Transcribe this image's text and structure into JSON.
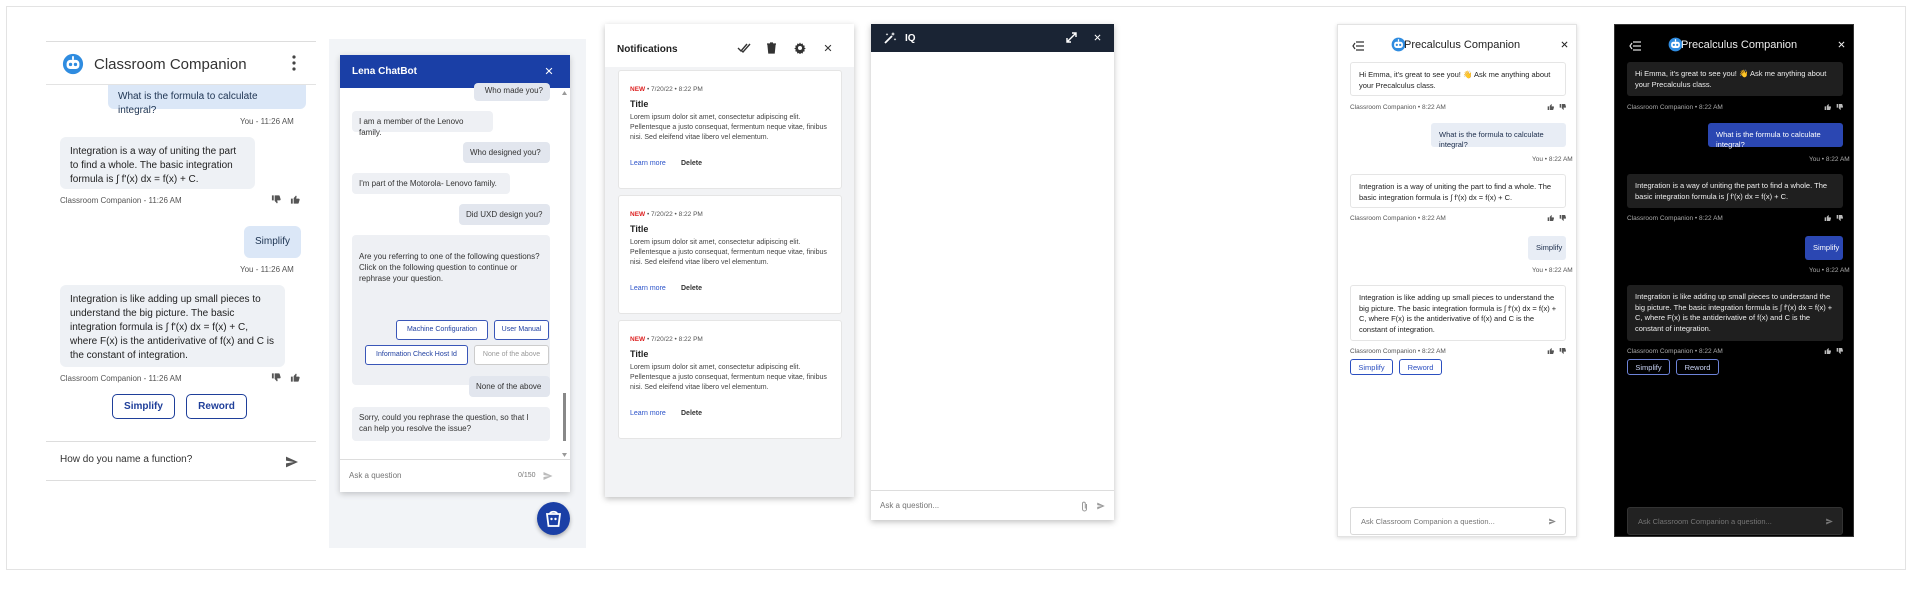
{
  "classroom": {
    "title": "Classroom Companion",
    "msg_user_formula": "What is the formula to calculate integral?",
    "meta_you_1": "You - 11:26 AM",
    "msg_bot_definition": "Integration is a way of uniting the part to find a whole.  The basic integration formula is ∫ f'(x) dx = f(x) + C.",
    "meta_bot_1": "Classroom Companion  - 11:26 AM",
    "msg_user_simplify": "Simplify",
    "meta_you_2": "You - 11:26 AM",
    "msg_bot_simple": "Integration is like adding up small pieces to understand the big picture.  The basic integration formula is ∫ f'(x) dx = f(x) + C, where F(x) is the antiderivative of f(x) and C is the constant of integration.",
    "meta_bot_2": "Classroom Companion  - 11:26 AM",
    "btn_simplify": "Simplify",
    "btn_reword": "Reword",
    "input_value": "How do you name a function?"
  },
  "lena": {
    "title": "Lena ChatBot",
    "msg_who_made": "Who made you?",
    "msg_member": "I am a member of the Lenovo family.",
    "msg_who_designed": "Who designed you?",
    "msg_motorola": "I'm part of the Motorola- Lenovo family.",
    "msg_uxd": "Did UXD design you?",
    "msg_referring": "Are you referring to one of the following questions?\nClick on the following question to continue or rephrase your question.",
    "chip_machine": "Machine Configuration",
    "chip_manual": "User Manual",
    "chip_info": "Information Check Host Id",
    "chip_none_disabled": "None of the above",
    "msg_none": "None of the above",
    "msg_sorry": "Sorry, could you rephrase the question, so that I can help you resolve the issue?",
    "input_placeholder": "Ask a question",
    "char_count": "0/150"
  },
  "notifications": {
    "title": "Notifications",
    "items": [
      {
        "badge": "NEW",
        "date": " • 7/20/22 • 8:22 PM",
        "title": "Title",
        "body": "Lorem ipsum dolor sit amet, consectetur adipiscing elit. Pellentesque a justo consequat, fermentum neque vitae, finibus nisi. Sed eleifend vitae libero vel elementum.",
        "learn_more": "Learn more",
        "delete": "Delete"
      },
      {
        "badge": "NEW",
        "date": " • 7/20/22 • 8:22 PM",
        "title": "Title",
        "body": "Lorem ipsum dolor sit amet, consectetur adipiscing elit. Pellentesque a justo consequat, fermentum neque vitae, finibus nisi. Sed eleifend vitae libero vel elementum.",
        "learn_more": "Learn more",
        "delete": "Delete"
      },
      {
        "badge": "NEW",
        "date": " • 7/20/22 • 8:22 PM",
        "title": "Title",
        "body": "Lorem ipsum dolor sit amet, consectetur adipiscing elit. Pellentesque a justo consequat, fermentum neque vitae, finibus nisi. Sed eleifend vitae libero vel elementum.",
        "learn_more": "Learn more",
        "delete": "Delete"
      }
    ]
  },
  "iq": {
    "title": "IQ",
    "input_placeholder": "Ask a question..."
  },
  "precalc": {
    "title": "Precalculus Companion",
    "msg_greeting": "Hi Emma, it's great to see you! 👋 Ask me anything about your Precalculus class.",
    "meta_bot_1": "Classroom Companion  •  8:22 AM",
    "msg_user_formula": "What is the formula to calculate integral?",
    "meta_you_1": "You  •  8:22 AM",
    "msg_bot_definition": "Integration is a way of uniting the part to find a whole.  The basic integration formula is ∫ f'(x) dx = f(x) + C.",
    "meta_bot_2": "Classroom Companion  •  8:22 AM",
    "msg_user_simplify": "Simplify",
    "meta_you_2": "You  •  8:22 AM",
    "msg_bot_simple": "Integration is like adding up small pieces to understand the big picture.  The basic integration formula is ∫ f'(x) dx = f(x) + C, where F(x) is the antiderivative of f(x) and C is the constant of integration.",
    "meta_bot_3": "Classroom Companion  •  8:22 AM",
    "btn_simplify": "Simplify",
    "btn_reword": "Reword",
    "input_placeholder": "Ask Classroom Companion a question..."
  },
  "colors": {
    "brand_blue": "#1a3fa6",
    "iq_header": "#1a2434",
    "dark_user_bubble": "#2b47b2",
    "new_badge": "#d22222"
  },
  "icons": {
    "companion_logo": "robot-icon",
    "kebab": "kebab-menu-icon",
    "send": "send-icon",
    "thumbs_down": "thumbs-down-icon",
    "thumbs_up": "thumbs-up-icon",
    "close": "close-icon",
    "mark_read": "double-check-icon",
    "delete_all": "trash-icon",
    "settings": "gear-icon",
    "wand": "magic-wand-icon",
    "expand": "expand-icon",
    "attach": "paperclip-icon",
    "menu": "menu-collapse-icon",
    "chatbot_fab": "chatbot-icon"
  }
}
